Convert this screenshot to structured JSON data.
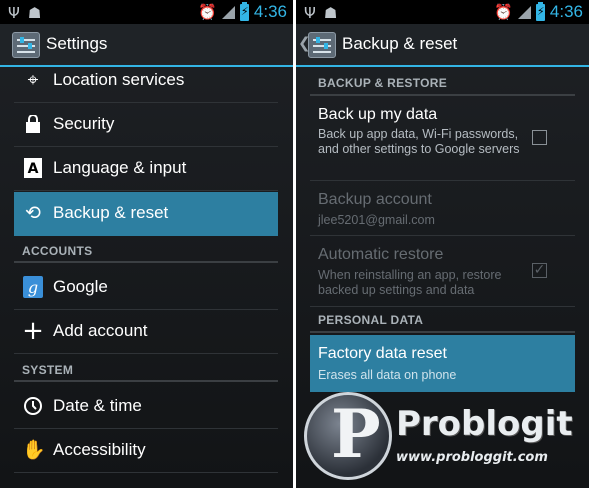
{
  "status_bar": {
    "time": "4:36"
  },
  "left": {
    "title": "Settings",
    "items_top": [
      {
        "label": "Location services",
        "icon": "location-icon"
      },
      {
        "label": "Security",
        "icon": "lock-icon"
      },
      {
        "label": "Language & input",
        "icon": "language-icon"
      },
      {
        "label": "Backup & reset",
        "icon": "backup-icon",
        "selected": true
      }
    ],
    "section_accounts": "ACCOUNTS",
    "items_accounts": [
      {
        "label": "Google",
        "icon": "google-icon"
      },
      {
        "label": "Add account",
        "icon": "plus-icon"
      }
    ],
    "section_system": "SYSTEM",
    "items_system": [
      {
        "label": "Date & time",
        "icon": "clock-icon"
      },
      {
        "label": "Accessibility",
        "icon": "hand-icon"
      }
    ]
  },
  "right": {
    "title": "Backup & reset",
    "section_backup": "BACKUP & RESTORE",
    "backup_data": {
      "title": "Back up my data",
      "summary": "Back up app data, Wi-Fi passwords, and other settings to Google servers",
      "checked": false
    },
    "backup_account": {
      "title": "Backup account",
      "summary": "jlee5201@gmail.com"
    },
    "auto_restore": {
      "title": "Automatic restore",
      "summary": "When reinstalling an app, restore backed up settings and data",
      "checked": true
    },
    "section_personal": "PERSONAL DATA",
    "factory_reset": {
      "title": "Factory data reset",
      "summary": "Erases all data on phone"
    }
  },
  "watermark": {
    "logo_letter": "P",
    "brand": "Problogit",
    "url": "www.probloggit.com"
  },
  "colors": {
    "accent": "#33b5e5",
    "selected": "#2d7fa1"
  }
}
